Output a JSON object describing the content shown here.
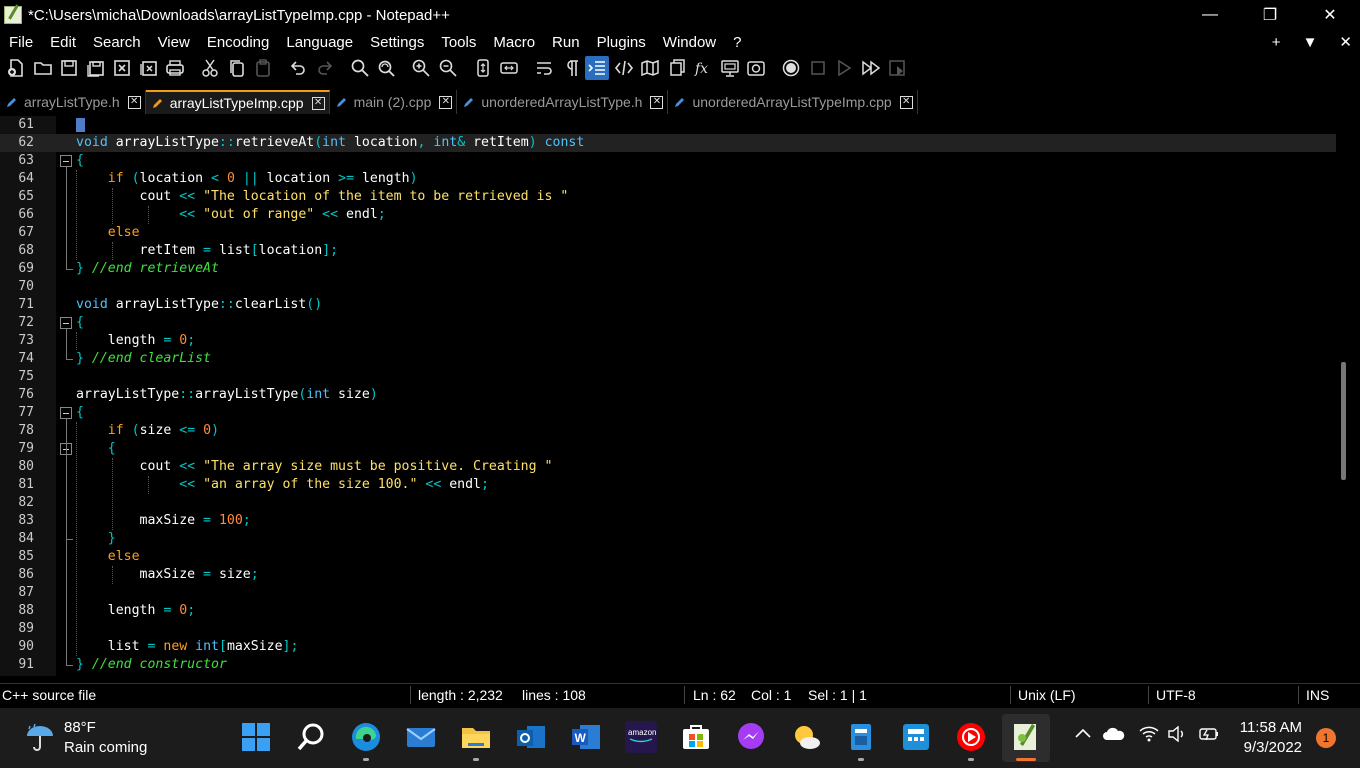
{
  "window": {
    "title": "*C:\\Users\\micha\\Downloads\\arrayListTypeImp.cpp - Notepad++",
    "minimize": "—",
    "restore": "❐",
    "close": "✕"
  },
  "menu": {
    "items": [
      "File",
      "Edit",
      "Search",
      "View",
      "Encoding",
      "Language",
      "Settings",
      "Tools",
      "Macro",
      "Run",
      "Plugins",
      "Window",
      "?"
    ],
    "right": [
      "+",
      "▼",
      "✕"
    ]
  },
  "tabs": [
    {
      "label": "arrayListType.h",
      "active": false
    },
    {
      "label": "arrayListTypeImp.cpp",
      "active": true
    },
    {
      "label": "main (2).cpp",
      "active": false
    },
    {
      "label": "unorderedArrayListType.h",
      "active": false
    },
    {
      "label": "unorderedArrayListTypeImp.cpp",
      "active": false
    }
  ],
  "editor": {
    "line_numbers": [
      "61",
      "62",
      "63",
      "64",
      "65",
      "66",
      "67",
      "68",
      "69",
      "70",
      "71",
      "72",
      "73",
      "74",
      "75",
      "76",
      "77",
      "78",
      "79",
      "80",
      "81",
      "82",
      "83",
      "84",
      "85",
      "86",
      "87",
      "88",
      "89",
      "90",
      "91"
    ],
    "lines": [
      "",
      "void arrayListType::retrieveAt(int location, int& retItem) const",
      "{",
      "    if (location < 0 || location >= length)",
      "        cout << \"The location of the item to be retrieved is \"",
      "             << \"out of range\" << endl;",
      "    else",
      "        retItem = list[location];",
      "} //end retrieveAt",
      "",
      "void arrayListType::clearList()",
      "{",
      "    length = 0;",
      "} //end clearList",
      "",
      "arrayListType::arrayListType(int size)",
      "{",
      "    if (size <= 0)",
      "    {",
      "        cout << \"The array size must be positive. Creating \"",
      "             << \"an array of the size 100.\" << endl;",
      "",
      "        maxSize = 100;",
      "    }",
      "    else",
      "        maxSize = size;",
      "",
      "    length = 0;",
      "",
      "    list = new int[maxSize];",
      "} //end constructor"
    ]
  },
  "status": {
    "file_type": "C++ source file",
    "length": "length : 2,232",
    "lines": "lines : 108",
    "ln": "Ln : 62",
    "col": "Col : 1",
    "sel": "Sel : 1 | 1",
    "eol": "Unix (LF)",
    "encoding": "UTF-8",
    "mode": "INS"
  },
  "taskbar": {
    "weather_temp": "88°F",
    "weather_desc": "Rain coming",
    "time": "11:58 AM",
    "date": "9/3/2022",
    "notifications": "1",
    "amazon_music_label": "amazon music"
  }
}
